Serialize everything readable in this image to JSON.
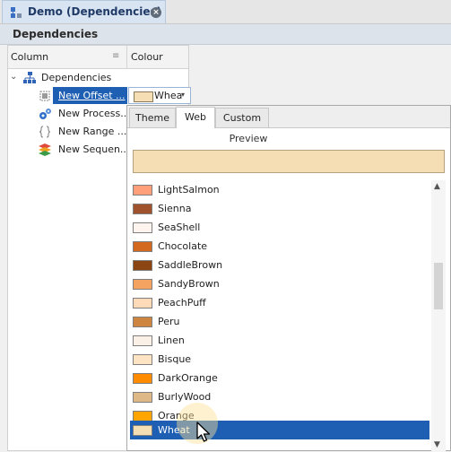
{
  "window": {
    "tab_title": "Demo (Dependencies)",
    "close_glyph": "×"
  },
  "panel": {
    "title": "Dependencies"
  },
  "grid": {
    "columns": {
      "column": "Column",
      "colour": "Colour"
    },
    "sort_glyph": "≡",
    "tree": [
      {
        "label": "Dependencies",
        "icon": "hierarchy-icon",
        "expanded": true
      },
      {
        "label": "New Offset ...",
        "icon": "offset-icon",
        "selected": true
      },
      {
        "label": "New Process...",
        "icon": "process-gears-icon"
      },
      {
        "label": "New Range ...",
        "icon": "range-braces-icon"
      },
      {
        "label": "New Sequen...",
        "icon": "sequence-layers-icon"
      }
    ],
    "expander_glyph": "⌄",
    "colour_cell": {
      "text": "Whea",
      "swatch": "#F5DEB3",
      "arrow": "▾"
    }
  },
  "picker": {
    "tabs": [
      "Theme",
      "Web",
      "Custom"
    ],
    "active_tab": "Web",
    "preview_label": "Preview",
    "preview_color": "#F5DEB3",
    "scroll_up": "▲",
    "scroll_down": "▼",
    "colors": [
      {
        "name": "LightSalmon",
        "hex": "#FFA07A"
      },
      {
        "name": "Sienna",
        "hex": "#A0522D"
      },
      {
        "name": "SeaShell",
        "hex": "#FFF5EE"
      },
      {
        "name": "Chocolate",
        "hex": "#D2691E"
      },
      {
        "name": "SaddleBrown",
        "hex": "#8B4513"
      },
      {
        "name": "SandyBrown",
        "hex": "#F4A460"
      },
      {
        "name": "PeachPuff",
        "hex": "#FFDAB9"
      },
      {
        "name": "Peru",
        "hex": "#CD853F"
      },
      {
        "name": "Linen",
        "hex": "#FAF0E6"
      },
      {
        "name": "Bisque",
        "hex": "#FFE4C4"
      },
      {
        "name": "DarkOrange",
        "hex": "#FF8C00"
      },
      {
        "name": "BurlyWood",
        "hex": "#DEB887"
      },
      {
        "name": "Orange",
        "hex": "#FFA500"
      },
      {
        "name": "Wheat",
        "hex": "#F5DEB3",
        "selected": true
      }
    ]
  },
  "accent": "#1E5FB4"
}
